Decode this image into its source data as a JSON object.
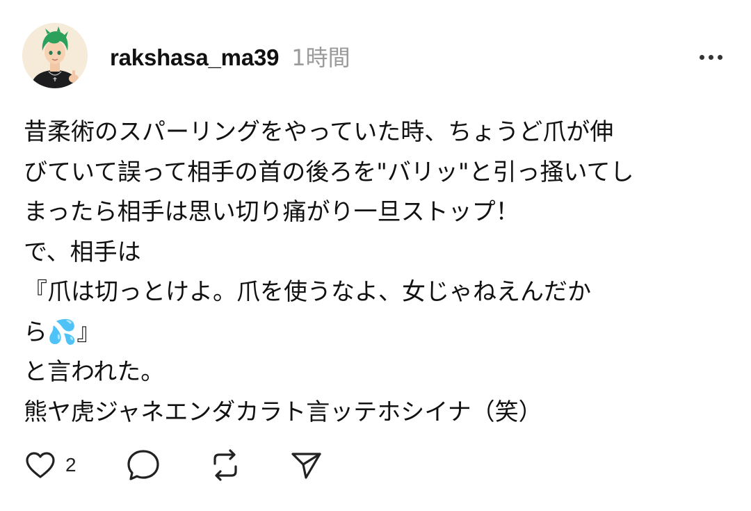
{
  "post": {
    "username": "rakshasa_ma39",
    "time": "1時間",
    "body_lines": [
      "昔柔術のスパーリングをやっていた時、ちょうど爪が伸",
      "びていて誤って相手の首の後ろを\"バリッ\"と引っ掻いてし",
      "まったら相手は思い切り痛がり一旦ストップ！",
      "で、相手は",
      "『爪は切っとけよ。爪を使うなよ、女じゃねえんだか",
      "ら💦』",
      "と言われた。",
      "熊ヤ虎ジャネエンダカラト言ッテホシイナ（笑）"
    ],
    "like_count": "2"
  },
  "icons": {
    "avatar": "user-avatar",
    "more": "more-options-icon",
    "like": "heart-icon",
    "reply": "comment-bubble-icon",
    "repost": "repost-icon",
    "share": "send-icon"
  },
  "colors": {
    "text": "#111111",
    "muted": "#9a9a9a",
    "avatar_hair": "#2aa05a",
    "avatar_bg": "#f6ead9"
  }
}
